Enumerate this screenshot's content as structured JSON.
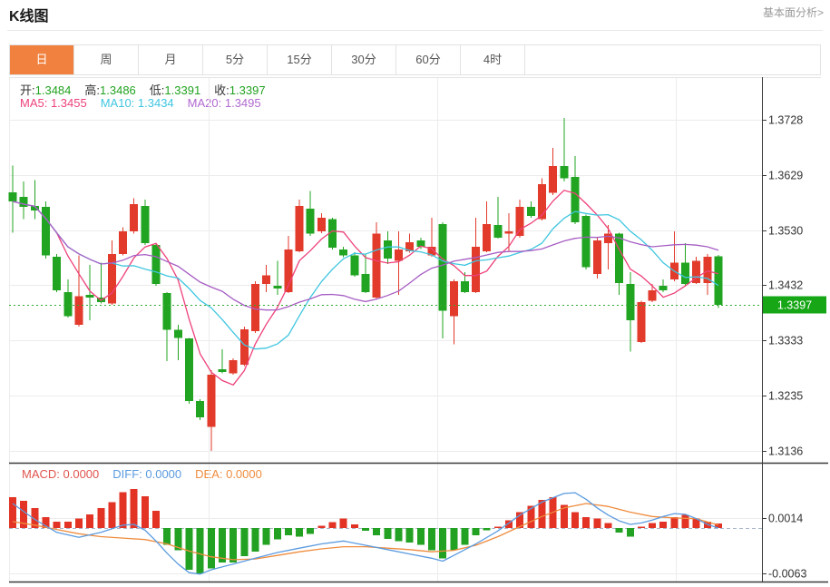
{
  "page": {
    "title": "K线图",
    "link_label": "基本面分析>"
  },
  "tabs": {
    "items": [
      "日",
      "周",
      "月",
      "5分",
      "15分",
      "30分",
      "60分",
      "4时"
    ],
    "active_index": 0
  },
  "legend": {
    "ohlc": {
      "label_color": "#333333",
      "value_color": "#21a21f",
      "items": [
        {
          "label": "开:",
          "value": "1.3484"
        },
        {
          "label": "高:",
          "value": "1.3486"
        },
        {
          "label": "低:",
          "value": "1.3391"
        },
        {
          "label": "收:",
          "value": "1.3397"
        }
      ]
    },
    "ma": {
      "items": [
        {
          "label": "MA5:",
          "value": "1.3455",
          "color": "#ee4179"
        },
        {
          "label": "MA10:",
          "value": "1.3434",
          "color": "#3fc6e0"
        },
        {
          "label": "MA20:",
          "value": "1.3495",
          "color": "#b169d1"
        }
      ]
    },
    "macd": {
      "items": [
        {
          "label": "MACD:",
          "value": "0.0000",
          "color": "#e05550"
        },
        {
          "label": "DIFF:",
          "value": "0.0000",
          "color": "#5b9be0"
        },
        {
          "label": "DEA:",
          "value": "0.0000",
          "color": "#ef8c3e"
        }
      ]
    }
  },
  "colors": {
    "up": "#e23a2b",
    "down": "#21a421",
    "hist_up": "#e23325",
    "hist_down": "#22a122",
    "ma5": "#ee4179",
    "ma10": "#3fc6e0",
    "ma20": "#a75ec4",
    "diff": "#5b9be0",
    "dea": "#ef8c3e",
    "badge": "#16a616",
    "tab_active": "#f0813e",
    "grid": "#ececec",
    "axis": "#3a3a3a",
    "tick_text": "#333333",
    "price_dotted": "#33aa33",
    "zero_dashed": "#aab8cc"
  },
  "chart_data": {
    "type": "candlestick",
    "title": "K线图",
    "legend_position": "top-left-overlay",
    "grid": true,
    "price_axis": {
      "side": "right",
      "ticks": [
        "1.3728",
        "1.3629",
        "1.3530",
        "1.3432",
        "1.3333",
        "1.3235",
        "1.3136"
      ],
      "current_price": "1.3397",
      "range_top": 1.3804,
      "range_bottom": 1.3115
    },
    "macd_axis": {
      "ticks": [
        "0.0014",
        "-0.0063"
      ],
      "zero": 0.0
    },
    "v_gridlines_x": [
      230,
      482,
      745
    ],
    "ma_periods": [
      5,
      10,
      20
    ],
    "candles_ohlc": [
      [
        1.3598,
        1.3646,
        1.3526,
        1.3582
      ],
      [
        1.359,
        1.3618,
        1.355,
        1.3572
      ],
      [
        1.3574,
        1.362,
        1.355,
        1.3566
      ],
      [
        1.3572,
        1.3582,
        1.348,
        1.3485
      ],
      [
        1.3483,
        1.3488,
        1.342,
        1.3423
      ],
      [
        1.342,
        1.3442,
        1.3374,
        1.3377
      ],
      [
        1.3361,
        1.3485,
        1.3358,
        1.3412
      ],
      [
        1.3415,
        1.3468,
        1.3369,
        1.341
      ],
      [
        1.341,
        1.3472,
        1.3399,
        1.3402
      ],
      [
        1.3399,
        1.3512,
        1.3397,
        1.3488
      ],
      [
        1.3488,
        1.3536,
        1.3485,
        1.3528
      ],
      [
        1.3528,
        1.3588,
        1.3524,
        1.3577
      ],
      [
        1.3574,
        1.3585,
        1.3504,
        1.3507
      ],
      [
        1.3504,
        1.3507,
        1.3431,
        1.3434
      ],
      [
        1.3418,
        1.342,
        1.3296,
        1.3352
      ],
      [
        1.3352,
        1.3361,
        1.3298,
        1.3338
      ],
      [
        1.3337,
        1.3338,
        1.322,
        1.3225
      ],
      [
        1.3225,
        1.3228,
        1.3191,
        1.3196
      ],
      [
        1.3179,
        1.328,
        1.3136,
        1.3272
      ],
      [
        1.3282,
        1.3317,
        1.3274,
        1.3277
      ],
      [
        1.3274,
        1.3301,
        1.3272,
        1.3298
      ],
      [
        1.329,
        1.3358,
        1.3287,
        1.3353
      ],
      [
        1.335,
        1.3439,
        1.3347,
        1.3434
      ],
      [
        1.3434,
        1.3468,
        1.342,
        1.345
      ],
      [
        1.3431,
        1.3476,
        1.3415,
        1.3426
      ],
      [
        1.342,
        1.352,
        1.3418,
        1.3496
      ],
      [
        1.3493,
        1.3585,
        1.3491,
        1.3574
      ],
      [
        1.3569,
        1.3601,
        1.352,
        1.3524
      ],
      [
        1.3528,
        1.3561,
        1.3525,
        1.3553
      ],
      [
        1.355,
        1.3553,
        1.3496,
        1.3499
      ],
      [
        1.3496,
        1.3501,
        1.3482,
        1.3485
      ],
      [
        1.3485,
        1.3491,
        1.3447,
        1.345
      ],
      [
        1.3452,
        1.3488,
        1.3418,
        1.342
      ],
      [
        1.341,
        1.3545,
        1.3407,
        1.3524
      ],
      [
        1.3512,
        1.3528,
        1.347,
        1.348
      ],
      [
        1.3476,
        1.3528,
        1.3415,
        1.3496
      ],
      [
        1.3493,
        1.3524,
        1.349,
        1.3509
      ],
      [
        1.3512,
        1.3517,
        1.3497,
        1.3501
      ],
      [
        1.3485,
        1.3553,
        1.3483,
        1.3501
      ],
      [
        1.3541,
        1.3545,
        1.3337,
        1.3386
      ],
      [
        1.3377,
        1.3442,
        1.3326,
        1.3439
      ],
      [
        1.3439,
        1.3455,
        1.3418,
        1.342
      ],
      [
        1.342,
        1.3553,
        1.3418,
        1.3501
      ],
      [
        1.3493,
        1.3582,
        1.3491,
        1.3541
      ],
      [
        1.354,
        1.359,
        1.3515,
        1.3517
      ],
      [
        1.3524,
        1.3561,
        1.3493,
        1.3528
      ],
      [
        1.352,
        1.3585,
        1.3517,
        1.3572
      ],
      [
        1.3572,
        1.3582,
        1.3553,
        1.3556
      ],
      [
        1.355,
        1.3623,
        1.3548,
        1.3613
      ],
      [
        1.3597,
        1.3678,
        1.3593,
        1.3645
      ],
      [
        1.3645,
        1.3731,
        1.3618,
        1.3623
      ],
      [
        1.3626,
        1.3663,
        1.3541,
        1.3545
      ],
      [
        1.3556,
        1.3558,
        1.346,
        1.3464
      ],
      [
        1.3452,
        1.3517,
        1.3444,
        1.3512
      ],
      [
        1.3507,
        1.354,
        1.346,
        1.3524
      ],
      [
        1.3524,
        1.3526,
        1.3415,
        1.3436
      ],
      [
        1.3434,
        1.3455,
        1.3313,
        1.3369
      ],
      [
        1.333,
        1.3404,
        1.3329,
        1.3402
      ],
      [
        1.3404,
        1.3434,
        1.3402,
        1.3423
      ],
      [
        1.3431,
        1.3442,
        1.342,
        1.3423
      ],
      [
        1.3442,
        1.3528,
        1.3439,
        1.3472
      ],
      [
        1.3472,
        1.3507,
        1.3431,
        1.3434
      ],
      [
        1.3436,
        1.3483,
        1.3434,
        1.3476
      ],
      [
        1.3436,
        1.3488,
        1.3415,
        1.3483
      ],
      [
        1.3484,
        1.3486,
        1.3391,
        1.3397
      ]
    ],
    "macd_hist": [
      0.0043,
      0.0038,
      0.0028,
      0.0015,
      0.0009,
      0.0009,
      0.0013,
      0.0019,
      0.0028,
      0.0036,
      0.005,
      0.0054,
      0.0044,
      0.0024,
      -0.0023,
      -0.0031,
      -0.0058,
      -0.0063,
      -0.0056,
      -0.0048,
      -0.0048,
      -0.0039,
      -0.0033,
      -0.0023,
      -0.0016,
      -0.001,
      -0.0012,
      -0.0008,
      0.0003,
      0.0008,
      0.0013,
      0.0005,
      -0.0004,
      -0.001,
      -0.0015,
      -0.0018,
      -0.002,
      -0.0023,
      -0.0031,
      -0.0042,
      -0.0031,
      -0.0023,
      -0.001,
      -0.0003,
      0.0002,
      0.0011,
      0.0022,
      0.0031,
      0.0039,
      0.0043,
      0.0032,
      0.0022,
      0.0015,
      0.0013,
      0.0007,
      -0.0006,
      -0.0012,
      0.0002,
      0.0007,
      0.0009,
      0.0015,
      0.0018,
      0.0013,
      0.0009,
      0.0006
    ],
    "diff_points": [
      [
        0,
        0.0034
      ],
      [
        2,
        0.0012
      ],
      [
        4,
        -0.0006
      ],
      [
        6,
        -0.0013
      ],
      [
        8,
        -0.0006
      ],
      [
        10,
        0.0004
      ],
      [
        11,
        0.0005
      ],
      [
        12,
        -0.0003
      ],
      [
        13,
        -0.0018
      ],
      [
        14,
        -0.0035
      ],
      [
        15,
        -0.005
      ],
      [
        16,
        -0.0062
      ],
      [
        17,
        -0.0064
      ],
      [
        18,
        -0.0058
      ],
      [
        20,
        -0.005
      ],
      [
        22,
        -0.0042
      ],
      [
        24,
        -0.0034
      ],
      [
        26,
        -0.0028
      ],
      [
        28,
        -0.0022
      ],
      [
        30,
        -0.0018
      ],
      [
        32,
        -0.0024
      ],
      [
        34,
        -0.003
      ],
      [
        36,
        -0.0036
      ],
      [
        38,
        -0.0042
      ],
      [
        39,
        -0.0046
      ],
      [
        40,
        -0.0038
      ],
      [
        42,
        -0.0022
      ],
      [
        44,
        -0.0004
      ],
      [
        46,
        0.0018
      ],
      [
        48,
        0.0036
      ],
      [
        50,
        0.0048
      ],
      [
        51,
        0.0049
      ],
      [
        52,
        0.004
      ],
      [
        53,
        0.0028
      ],
      [
        54,
        0.0018
      ],
      [
        55,
        0.001
      ],
      [
        56,
        0.0005
      ],
      [
        57,
        0.0007
      ],
      [
        58,
        0.0011
      ],
      [
        59,
        0.0016
      ],
      [
        60,
        0.002
      ],
      [
        61,
        0.0019
      ],
      [
        62,
        0.0013
      ],
      [
        63,
        0.0005
      ],
      [
        64,
        0.0
      ]
    ],
    "dea_points": [
      [
        0,
        0.0009
      ],
      [
        2,
        0.0004
      ],
      [
        4,
        -0.0002
      ],
      [
        6,
        -0.0008
      ],
      [
        8,
        -0.0012
      ],
      [
        10,
        -0.0014
      ],
      [
        12,
        -0.0016
      ],
      [
        14,
        -0.0022
      ],
      [
        16,
        -0.0032
      ],
      [
        18,
        -0.004
      ],
      [
        20,
        -0.0044
      ],
      [
        22,
        -0.0043
      ],
      [
        24,
        -0.0038
      ],
      [
        26,
        -0.0033
      ],
      [
        28,
        -0.0029
      ],
      [
        30,
        -0.0026
      ],
      [
        32,
        -0.0026
      ],
      [
        34,
        -0.0028
      ],
      [
        36,
        -0.003
      ],
      [
        38,
        -0.0033
      ],
      [
        40,
        -0.0031
      ],
      [
        42,
        -0.0024
      ],
      [
        44,
        -0.0012
      ],
      [
        46,
        0.0002
      ],
      [
        48,
        0.0016
      ],
      [
        50,
        0.0028
      ],
      [
        52,
        0.0034
      ],
      [
        54,
        0.003
      ],
      [
        56,
        0.0022
      ],
      [
        58,
        0.0016
      ],
      [
        60,
        0.0014
      ],
      [
        62,
        0.0013
      ],
      [
        64,
        0.0004
      ]
    ]
  }
}
